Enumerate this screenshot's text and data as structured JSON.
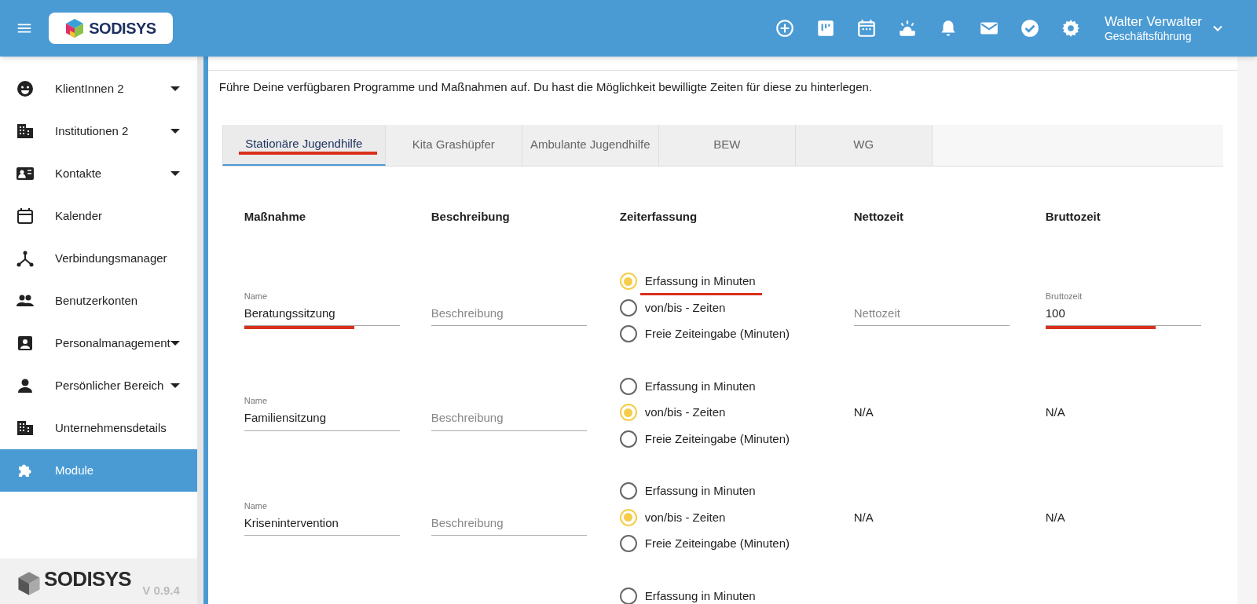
{
  "header": {
    "logo_text": "SODISYS",
    "user_name": "Walter Verwalter",
    "user_role": "Geschäftsführung"
  },
  "sidebar": {
    "items": [
      {
        "label": "KlientInnen 2",
        "dropdown": true,
        "selected": false
      },
      {
        "label": "Institutionen 2",
        "dropdown": true,
        "selected": false
      },
      {
        "label": "Kontakte",
        "dropdown": true,
        "selected": false
      },
      {
        "label": "Kalender",
        "dropdown": false,
        "selected": false
      },
      {
        "label": "Verbindungsmanager",
        "dropdown": false,
        "selected": false
      },
      {
        "label": "Benutzerkonten",
        "dropdown": false,
        "selected": false
      },
      {
        "label": "Personalmanagement",
        "dropdown": true,
        "selected": false
      },
      {
        "label": "Persönlicher Bereich",
        "dropdown": true,
        "selected": false
      },
      {
        "label": "Unternehmensdetails",
        "dropdown": false,
        "selected": false
      },
      {
        "label": "Module",
        "dropdown": false,
        "selected": true
      }
    ],
    "footer_logo": "SODISYS",
    "version": "V 0.9.4"
  },
  "intro": "Führe Deine verfügbaren Programme und Maßnahmen auf. Du hast die Möglichkeit bewilligte Zeiten für diese zu hinterlegen.",
  "tabs": [
    {
      "label": "Stationäre Jugendhilfe",
      "selected": true,
      "underlined": true
    },
    {
      "label": "Kita Grashüpfer",
      "selected": false,
      "underlined": false
    },
    {
      "label": "Ambulante Jugendhilfe",
      "selected": false,
      "underlined": false
    },
    {
      "label": "BEW",
      "selected": false,
      "underlined": false
    },
    {
      "label": "WG",
      "selected": false,
      "underlined": false
    }
  ],
  "table": {
    "columns": [
      "Maßnahme",
      "Beschreibung",
      "Zeiterfassung",
      "Nettozeit",
      "Bruttozeit"
    ],
    "rows": [
      {
        "name": {
          "label": "Name",
          "value": "Beratungssitzung",
          "underlined": true
        },
        "description": {
          "placeholder": "Beschreibung"
        },
        "time_options": [
          {
            "label": "Erfassung in Minuten",
            "selected": true,
            "underlined": true
          },
          {
            "label": "von/bis - Zeiten",
            "selected": false,
            "underlined": false
          },
          {
            "label": "Freie Zeiteingabe (Minuten)",
            "selected": false,
            "underlined": false
          }
        ],
        "netto": {
          "kind": "field",
          "placeholder": "Nettozeit"
        },
        "brutto": {
          "kind": "field",
          "label": "Bruttozeit",
          "value": "100",
          "underlined": true
        }
      },
      {
        "name": {
          "label": "Name",
          "value": "Familiensitzung",
          "underlined": false
        },
        "description": {
          "placeholder": "Beschreibung"
        },
        "time_options": [
          {
            "label": "Erfassung in Minuten",
            "selected": false,
            "underlined": false
          },
          {
            "label": "von/bis - Zeiten",
            "selected": true,
            "underlined": false
          },
          {
            "label": "Freie Zeiteingabe (Minuten)",
            "selected": false,
            "underlined": false
          }
        ],
        "netto": {
          "kind": "text",
          "text": "N/A"
        },
        "brutto": {
          "kind": "text",
          "text": "N/A"
        }
      },
      {
        "name": {
          "label": "Name",
          "value": "Krisenintervention",
          "underlined": false
        },
        "description": {
          "placeholder": "Beschreibung"
        },
        "time_options": [
          {
            "label": "Erfassung in Minuten",
            "selected": false,
            "underlined": false
          },
          {
            "label": "von/bis - Zeiten",
            "selected": true,
            "underlined": false
          },
          {
            "label": "Freie Zeiteingabe (Minuten)",
            "selected": false,
            "underlined": false
          }
        ],
        "netto": {
          "kind": "text",
          "text": "N/A"
        },
        "brutto": {
          "kind": "text",
          "text": "N/A"
        }
      },
      {
        "time_options": [
          {
            "label": "Erfassung in Minuten",
            "selected": false,
            "underlined": false
          }
        ]
      }
    ]
  }
}
